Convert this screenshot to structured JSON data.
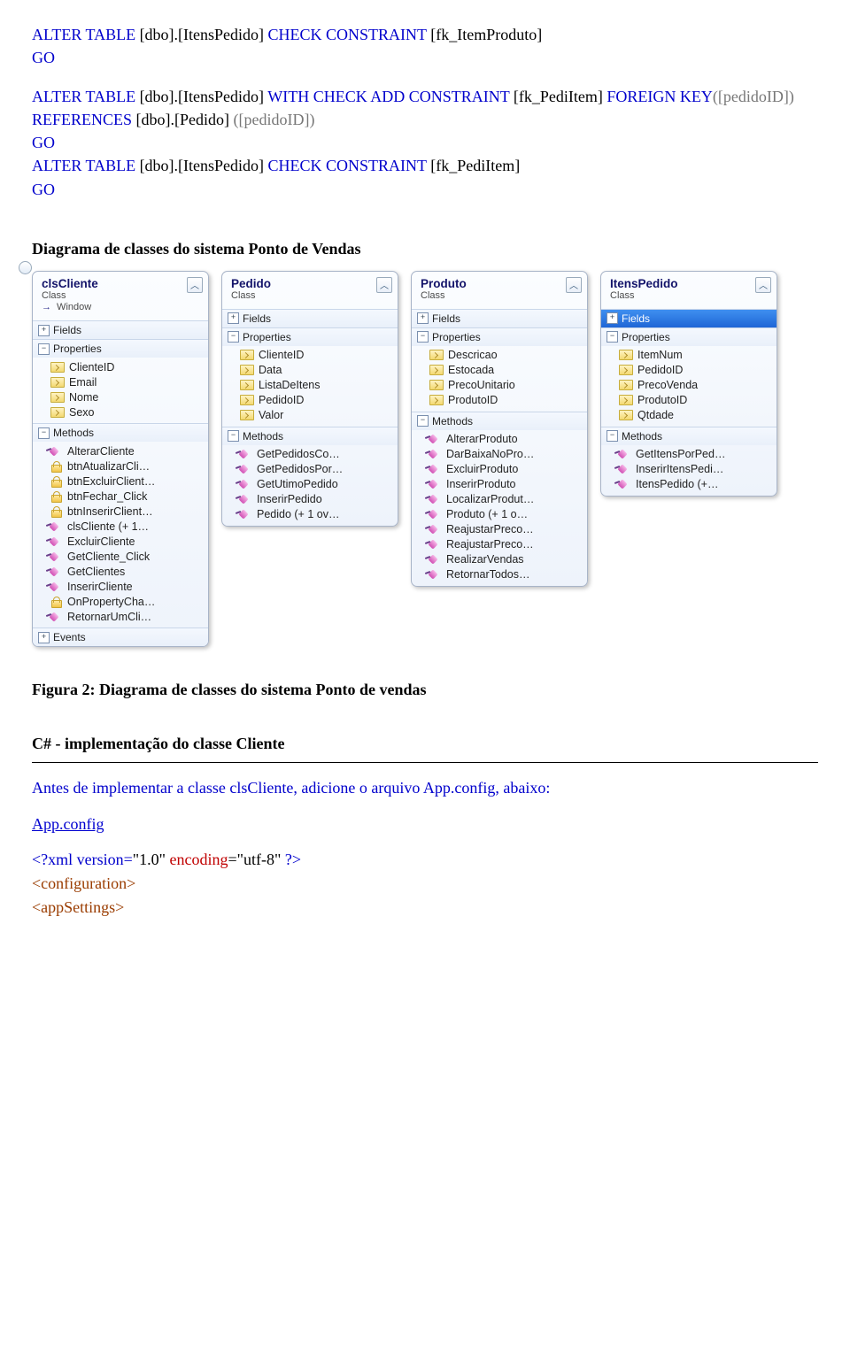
{
  "sql": {
    "l1_alter": "ALTER TABLE",
    "l1_obj": " [dbo].[ItensPedido] ",
    "l1_check": "CHECK CONSTRAINT",
    "l1_fk": " [fk_ItemProduto]",
    "go": "GO",
    "l4_alter": "ALTER TABLE",
    "l4_obj": " [dbo].[ItensPedido]  ",
    "l4_with": "WITH CHECK ADD  CONSTRAINT",
    "l4_fk": " [fk_PediItem] ",
    "l4_fkkw": "FOREIGN KEY",
    "l4_col": "([pedidoID])",
    "l5_ref": "REFERENCES",
    "l5_obj": " [dbo].[Pedido] ",
    "l5_col": "([pedidoID])",
    "l8_alter": "ALTER TABLE",
    "l8_obj": " [dbo].[ItensPedido] ",
    "l8_check": "CHECK CONSTRAINT",
    "l8_fk": " [fk_PediItem]"
  },
  "headings": {
    "diagram": "Diagrama de classes do sistema Ponto de Vendas",
    "figcap": "Figura 2: Diagrama de classes do sistema Ponto de vendas",
    "csharp": "C# - implementação do classe Cliente",
    "antes": "Antes de implementar a classe clsCliente, adicione o arquivo App.config, abaixo:",
    "appconfig": "App.config"
  },
  "xml": {
    "pi_open": "<?",
    "pi_name": "xml version",
    "pi_eq": "=",
    "pi_ver": "\"1.0\"",
    "pi_enc_attr": " encoding",
    "pi_enc_val": "=\"utf-8\" ",
    "pi_close": "?>",
    "tag1": "<configuration>",
    "tag2": " <appSettings>"
  },
  "panels": [
    {
      "title": "clsCliente",
      "sub1": "Class",
      "sub2": "Window",
      "hasHandle": true,
      "sections": [
        {
          "name": "Fields",
          "collapsed": true
        },
        {
          "name": "Properties",
          "collapsed": false,
          "items": [
            {
              "t": "prop",
              "l": "ClienteID"
            },
            {
              "t": "prop",
              "l": "Email"
            },
            {
              "t": "prop",
              "l": "Nome"
            },
            {
              "t": "prop",
              "l": "Sexo"
            }
          ]
        },
        {
          "name": "Methods",
          "collapsed": false,
          "items": [
            {
              "t": "method",
              "l": "AlterarCliente"
            },
            {
              "t": "lock",
              "l": "btnAtualizarCli…"
            },
            {
              "t": "lock",
              "l": "btnExcluirClient…"
            },
            {
              "t": "lock",
              "l": "btnFechar_Click"
            },
            {
              "t": "lock",
              "l": "btnInserirClient…"
            },
            {
              "t": "method",
              "l": "clsCliente (+ 1…"
            },
            {
              "t": "method",
              "l": "ExcluirCliente"
            },
            {
              "t": "method",
              "l": "GetCliente_Click"
            },
            {
              "t": "method",
              "l": "GetClientes"
            },
            {
              "t": "method",
              "l": "InserirCliente"
            },
            {
              "t": "lock",
              "l": "OnPropertyCha…"
            },
            {
              "t": "method",
              "l": "RetornarUmCli…"
            }
          ]
        },
        {
          "name": "Events",
          "collapsed": true
        }
      ]
    },
    {
      "title": "Pedido",
      "sub1": "Class",
      "sections": [
        {
          "name": "Fields",
          "collapsed": true
        },
        {
          "name": "Properties",
          "collapsed": false,
          "items": [
            {
              "t": "prop",
              "l": "ClienteID"
            },
            {
              "t": "prop",
              "l": "Data"
            },
            {
              "t": "prop",
              "l": "ListaDeItens"
            },
            {
              "t": "prop",
              "l": "PedidoID"
            },
            {
              "t": "prop",
              "l": "Valor"
            }
          ]
        },
        {
          "name": "Methods",
          "collapsed": false,
          "items": [
            {
              "t": "method",
              "l": "GetPedidosCo…"
            },
            {
              "t": "method",
              "l": "GetPedidosPor…"
            },
            {
              "t": "method",
              "l": "GetUtimoPedido"
            },
            {
              "t": "method",
              "l": "InserirPedido"
            },
            {
              "t": "method",
              "l": "Pedido (+ 1 ov…"
            }
          ]
        }
      ]
    },
    {
      "title": "Produto",
      "sub1": "Class",
      "sections": [
        {
          "name": "Fields",
          "collapsed": true
        },
        {
          "name": "Properties",
          "collapsed": false,
          "items": [
            {
              "t": "prop",
              "l": "Descricao"
            },
            {
              "t": "prop",
              "l": "Estocada"
            },
            {
              "t": "prop",
              "l": "PrecoUnitario"
            },
            {
              "t": "prop",
              "l": "ProdutoID"
            }
          ]
        },
        {
          "name": "Methods",
          "collapsed": false,
          "items": [
            {
              "t": "method",
              "l": "AlterarProduto"
            },
            {
              "t": "method",
              "l": "DarBaixaNoPro…"
            },
            {
              "t": "method",
              "l": "ExcluirProduto"
            },
            {
              "t": "method",
              "l": "InserirProduto"
            },
            {
              "t": "method",
              "l": "LocalizarProdut…"
            },
            {
              "t": "method",
              "l": "Produto (+ 1 o…"
            },
            {
              "t": "method",
              "l": "ReajustarPreco…"
            },
            {
              "t": "method",
              "l": "ReajustarPreco…"
            },
            {
              "t": "method",
              "l": "RealizarVendas"
            },
            {
              "t": "method",
              "l": "RetornarTodos…"
            }
          ]
        }
      ]
    },
    {
      "title": "ItensPedido",
      "sub1": "Class",
      "sections": [
        {
          "name": "Fields",
          "collapsed": true,
          "selected": true
        },
        {
          "name": "Properties",
          "collapsed": false,
          "items": [
            {
              "t": "prop",
              "l": "ItemNum"
            },
            {
              "t": "prop",
              "l": "PedidoID"
            },
            {
              "t": "prop",
              "l": "PrecoVenda"
            },
            {
              "t": "prop",
              "l": "ProdutoID"
            },
            {
              "t": "prop",
              "l": "Qtdade"
            }
          ]
        },
        {
          "name": "Methods",
          "collapsed": false,
          "items": [
            {
              "t": "method",
              "l": "GetItensPorPed…"
            },
            {
              "t": "method",
              "l": "InserirItensPedi…"
            },
            {
              "t": "method",
              "l": "ItensPedido (+…"
            }
          ]
        }
      ]
    }
  ]
}
